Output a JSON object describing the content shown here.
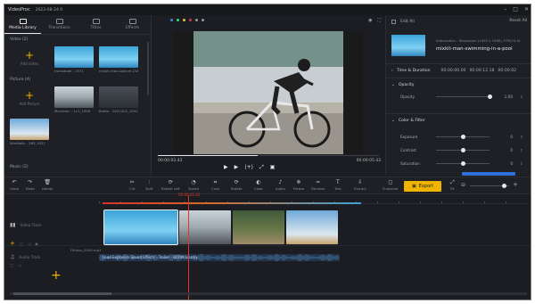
{
  "app": {
    "name": "VideoProc",
    "date": "2023-08-24 0"
  },
  "window_controls": [
    "–",
    "□",
    "✕"
  ],
  "left_panel": {
    "tabs": [
      {
        "label": "Media Library",
        "icon": "media-library-icon",
        "active": true
      },
      {
        "label": "Transitions",
        "icon": "transitions-icon",
        "active": false
      },
      {
        "label": "Titles",
        "icon": "titles-icon",
        "active": false
      },
      {
        "label": "Effects",
        "icon": "effects-icon",
        "active": false
      }
    ],
    "sections": {
      "video": "Video (2)",
      "picture": "Picture (4)",
      "music": "Music (2)"
    },
    "add_tiles": {
      "video": "Add Video",
      "picture": "Add Picture"
    },
    "video_items": [
      {
        "caption": "transitude - 1571",
        "style": "pool"
      },
      {
        "caption": "mixkit-man-swimm 2186",
        "style": "pool"
      }
    ],
    "picture_items": [
      {
        "caption": "Mountain - 1c1_1008",
        "style": "bike"
      },
      {
        "caption": "Bottle - 0021202_1002",
        "style": "dark"
      },
      {
        "caption": "Windfalls - 285_1021",
        "style": "sky"
      }
    ]
  },
  "preview": {
    "current_time": "00:00:02.43",
    "duration": "00:00:05.43",
    "progress": 0.45,
    "dots": [
      "#3a8fd8",
      "#3ad87a",
      "#d8c83a",
      "#d83a3a",
      "#9a9a9a",
      "#9a9a9a"
    ],
    "controls": [
      "▶",
      "▶",
      "⟨+⟩",
      "⤢",
      "▣"
    ]
  },
  "right_panel": {
    "edit_all": "Edit All",
    "reset": "Reset All",
    "info": "Information - Resolution (1920 x 1080), FPS(24.0)",
    "clip_title": "mixkit-man-swimming-in-a-pool",
    "time_duration": {
      "label": "Time & Duration",
      "start": "00:00:00.00",
      "end": "00:00:12.18",
      "length": "00:00:02"
    },
    "opacity": {
      "label": "Opacity",
      "row": "Opacity",
      "value": "1.00",
      "level": 1.0
    },
    "color_filter": {
      "label": "Color & Filter",
      "rows": [
        {
          "name": "Exposure",
          "value": "0",
          "level": 0.5
        },
        {
          "name": "Contrast",
          "value": "0",
          "level": 0.5
        },
        {
          "name": "Saturation",
          "value": "0",
          "level": 0.5
        }
      ]
    }
  },
  "toolbar": {
    "tools": [
      {
        "label": "Undo",
        "icon": "undo-icon"
      },
      {
        "label": "Redo",
        "icon": "redo-icon"
      },
      {
        "label": "Delete",
        "icon": "delete-icon"
      },
      {
        "label": "Cut",
        "icon": "cut-icon"
      },
      {
        "label": "Split",
        "icon": "split-icon"
      },
      {
        "label": "Rotate Left",
        "icon": "rotate-icon"
      },
      {
        "label": "Speed",
        "icon": "speed-icon"
      },
      {
        "label": "Crop",
        "icon": "crop-icon"
      },
      {
        "label": "Rotate",
        "icon": "rotate-icon"
      },
      {
        "label": "Color",
        "icon": "color-icon"
      },
      {
        "label": "Audio",
        "icon": "audio-icon"
      },
      {
        "label": "Freeze",
        "icon": "freeze-icon"
      },
      {
        "label": "Denoise",
        "icon": "denoise-icon"
      },
      {
        "label": "Text",
        "icon": "text-icon"
      },
      {
        "label": "Extract",
        "icon": "extract-icon"
      },
      {
        "label": "Snapshot",
        "icon": "snapshot-icon"
      }
    ],
    "export": "Export",
    "fit": "Fit"
  },
  "timeline": {
    "playhead_time": "00:00:02.43",
    "video_track": "Video Track",
    "audio_track": "Audio Track",
    "audio_file": "Fitness_0000.mp3",
    "audio_label": "Loud Explosion Sound Effects - Trailer - BOOM Library"
  }
}
